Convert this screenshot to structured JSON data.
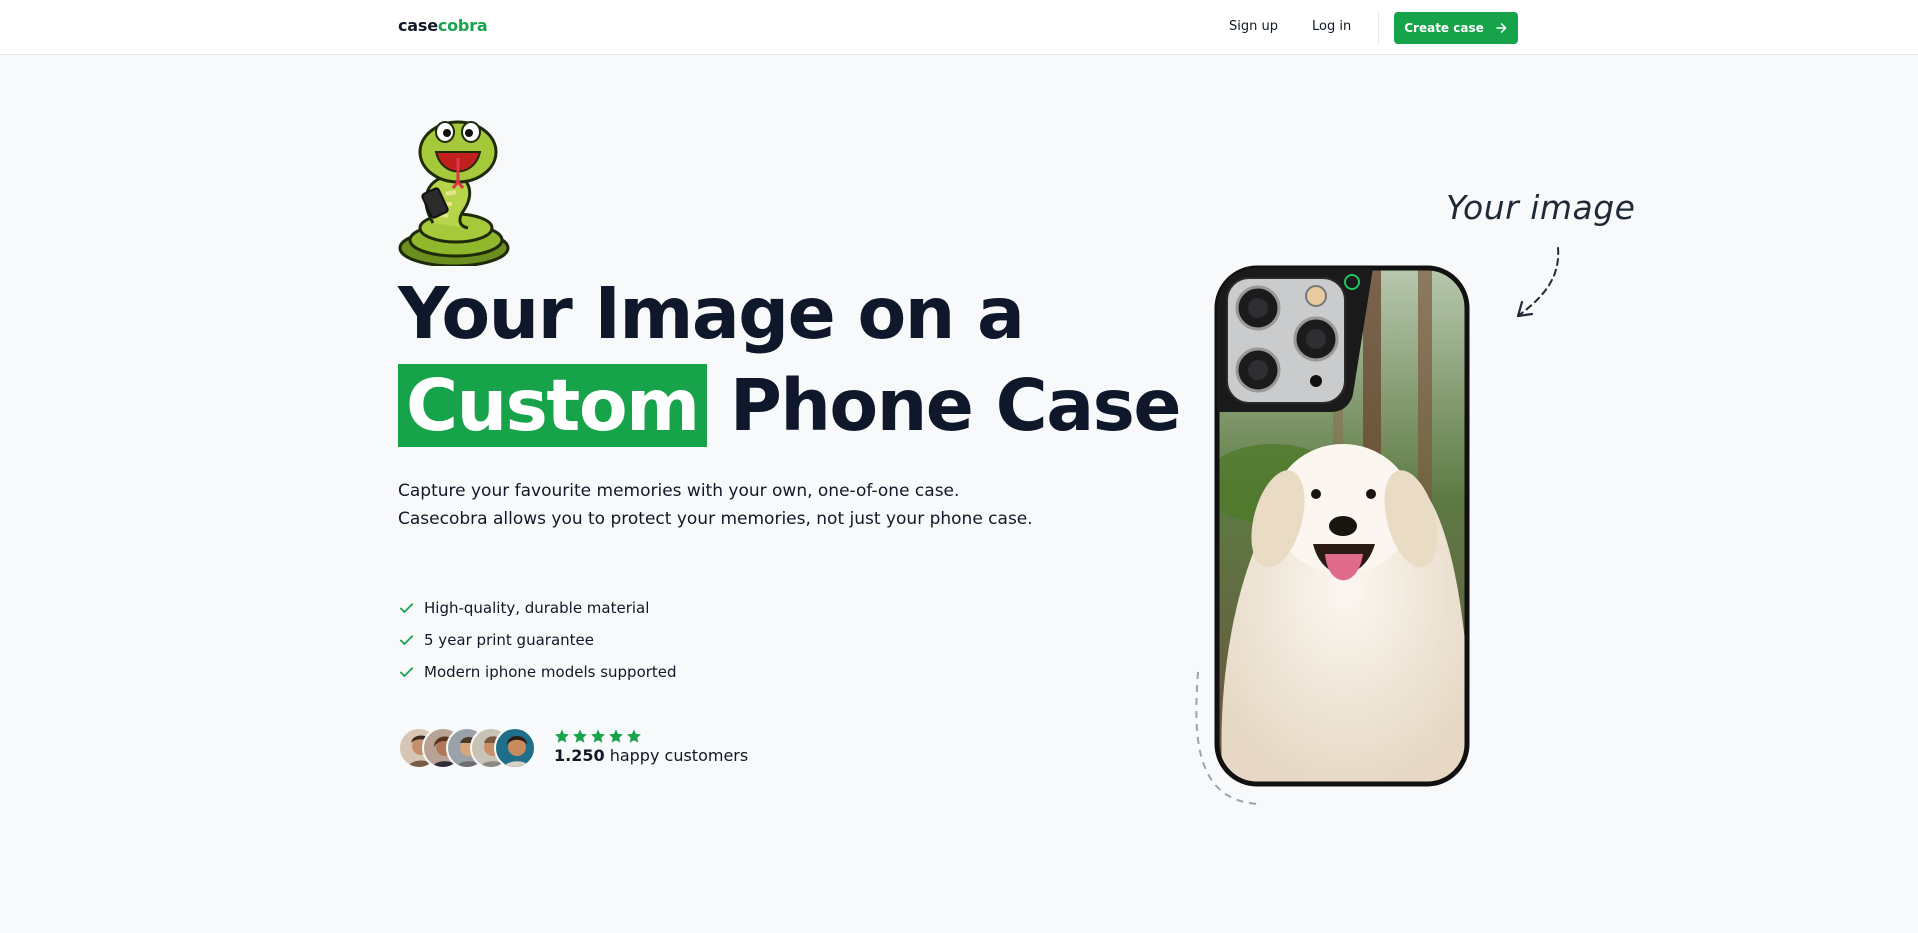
{
  "nav": {
    "logo_prefix": "case",
    "logo_suffix": "cobra",
    "signup": "Sign up",
    "login": "Log in",
    "create_case": "Create case"
  },
  "hero": {
    "headline_line1": "Your Image on a",
    "headline_highlight": "Custom",
    "headline_line2_rest": "Phone Case",
    "description": "Capture your favourite memories with your own, one-of-one case. Casecobra allows you to protect your memories, not just your phone case.",
    "features": [
      "High-quality, durable material",
      "5 year print guarantee",
      "Modern iphone models supported"
    ],
    "rating_stars": 5,
    "customers_count": "1.250",
    "customers_label": "happy customers"
  },
  "phone": {
    "annotation": "Your image"
  },
  "colors": {
    "accent": "#16a34a",
    "background": "#f8f9fa",
    "text": "#0f172a"
  }
}
